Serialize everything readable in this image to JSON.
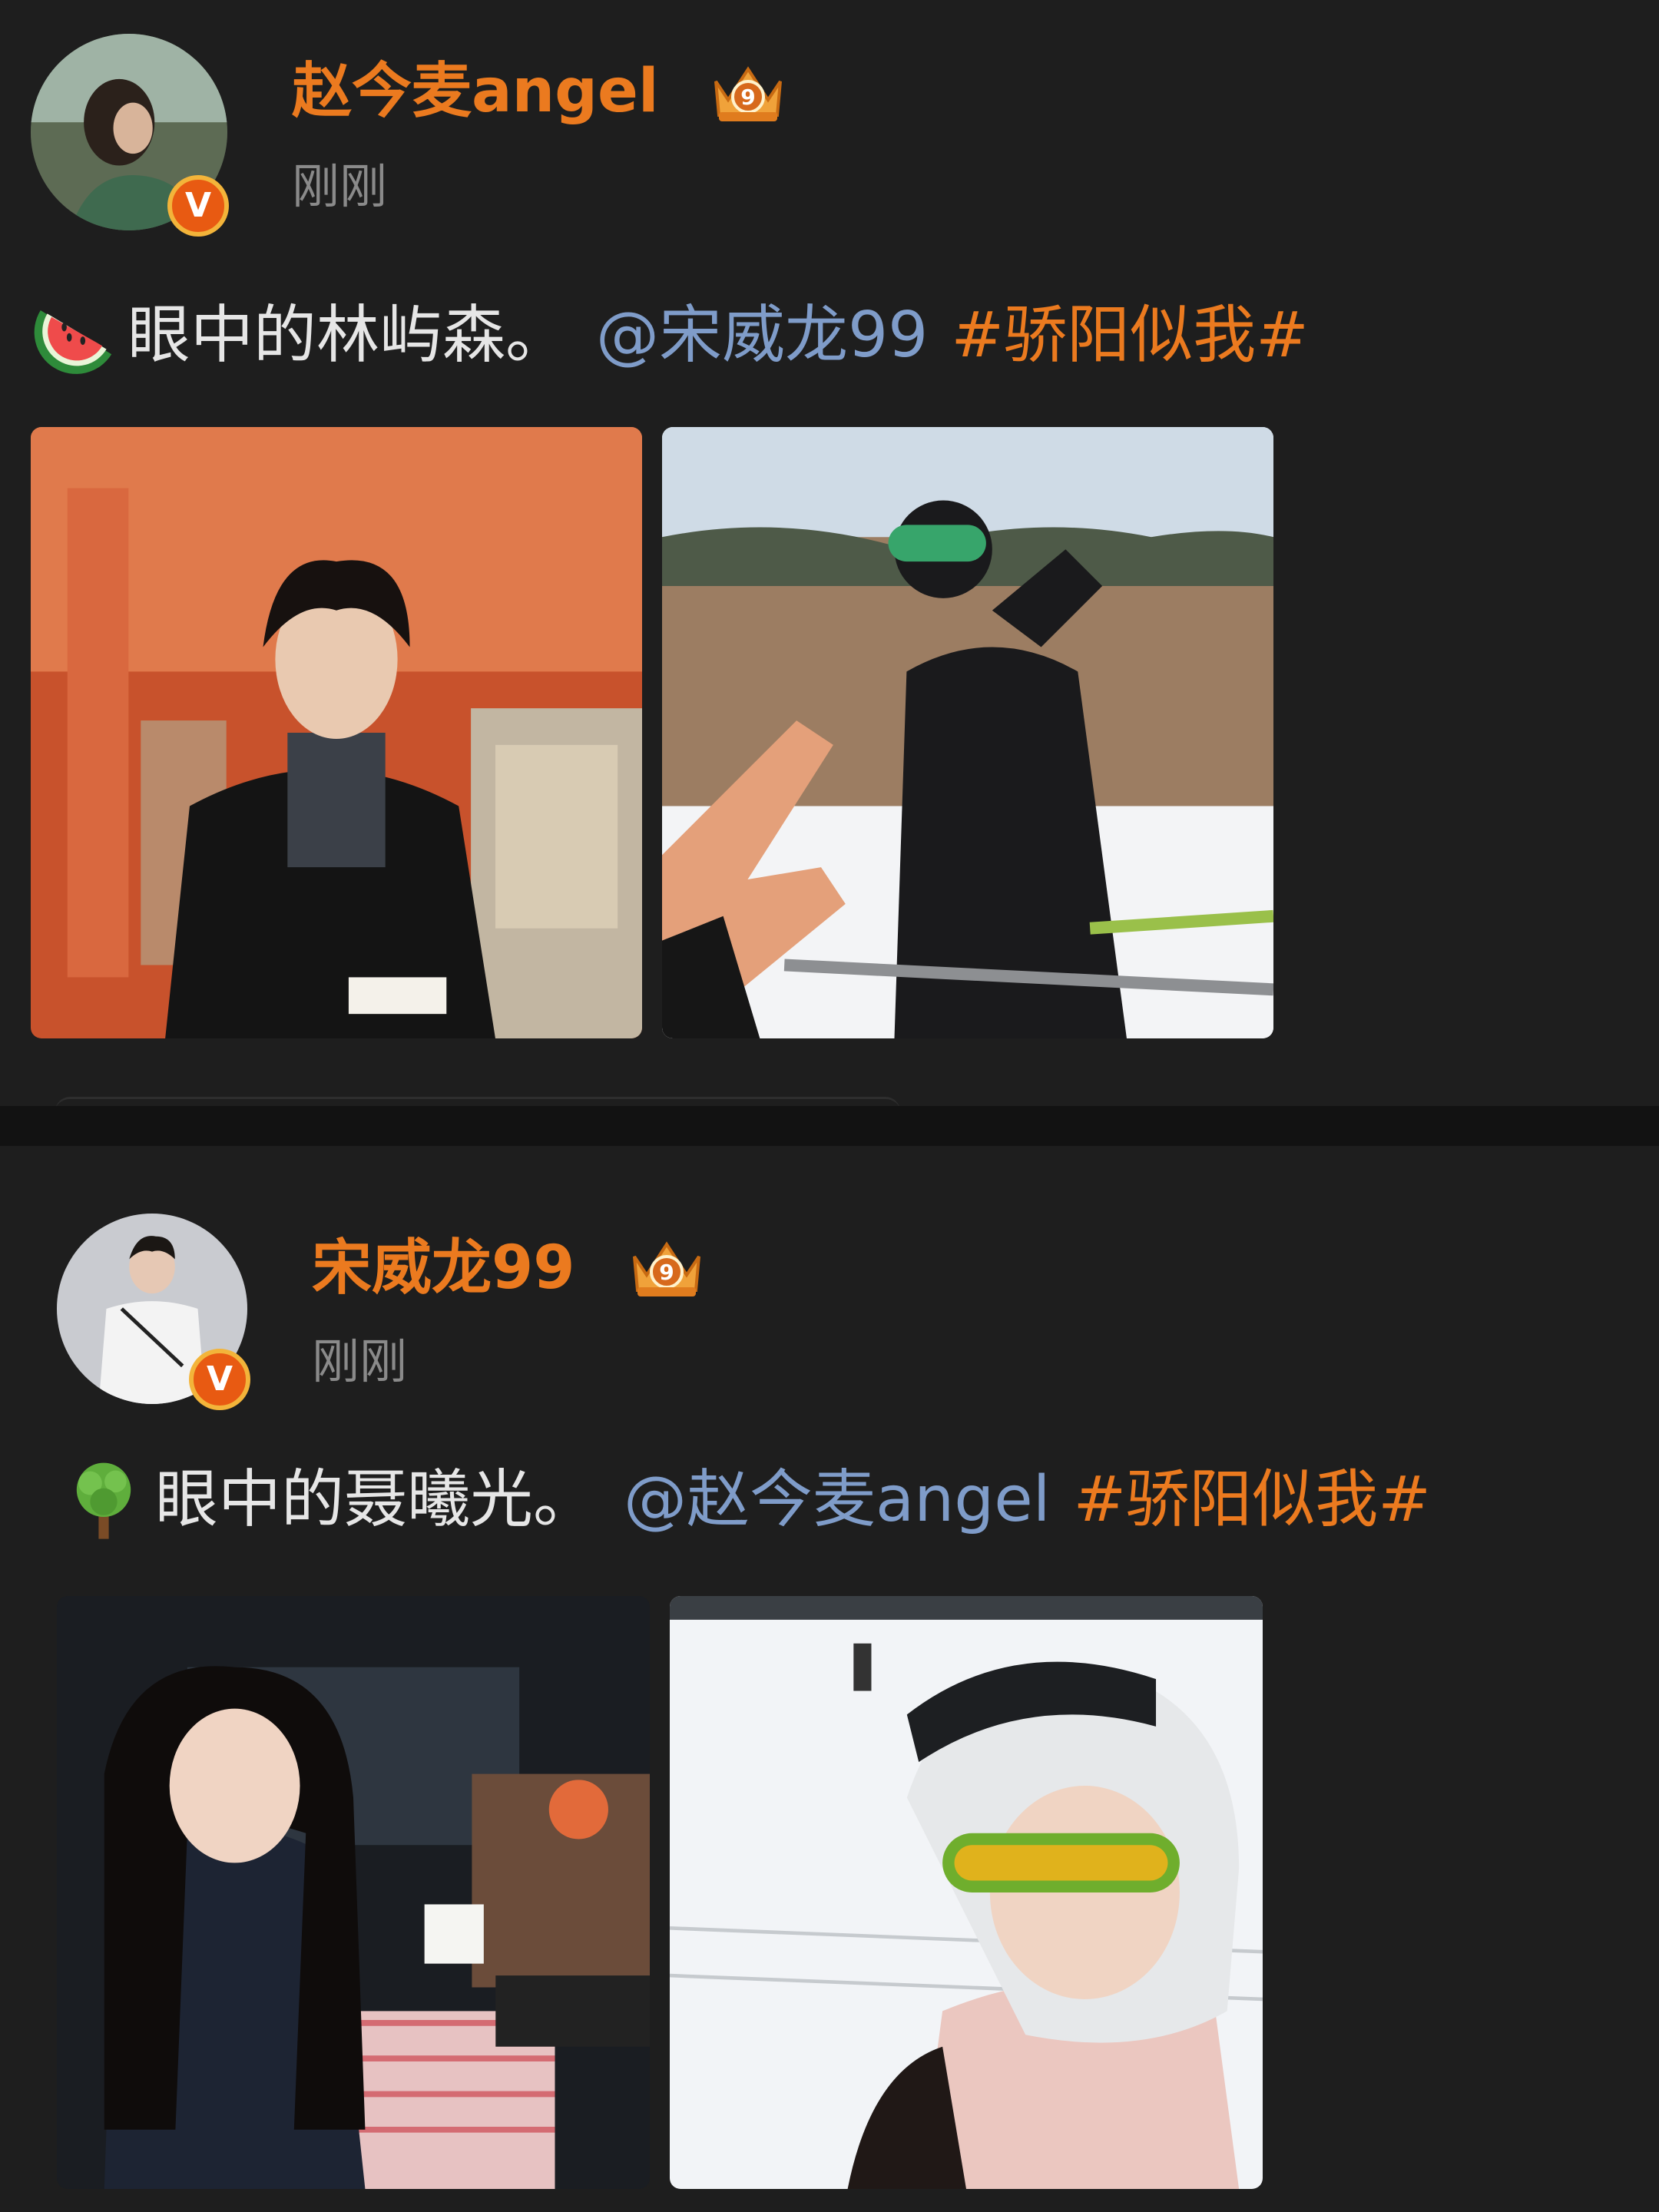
{
  "posts": [
    {
      "author": "赵今麦angel",
      "time": "刚刚",
      "caption_text": "眼中的林屿森。",
      "mention": "@宋威龙99",
      "hashtag": "#骄阳似我#",
      "emoji": "watermelon-emoji",
      "badge": "9",
      "verified": "V"
    },
    {
      "author": "宋威龙99",
      "time": "刚刚",
      "caption_text": "眼中的聂曦光。",
      "mention": "@赵今麦angel",
      "hashtag": "#骄阳似我#",
      "emoji": "tree-emoji",
      "badge": "9",
      "verified": "V"
    }
  ],
  "colors": {
    "background": "#1e1e1e",
    "username": "#eb7a1f",
    "mention": "#7f9cc9",
    "hashtag": "#eb7a1f",
    "caption": "#e6e6e6",
    "time": "#8a8a8a"
  }
}
